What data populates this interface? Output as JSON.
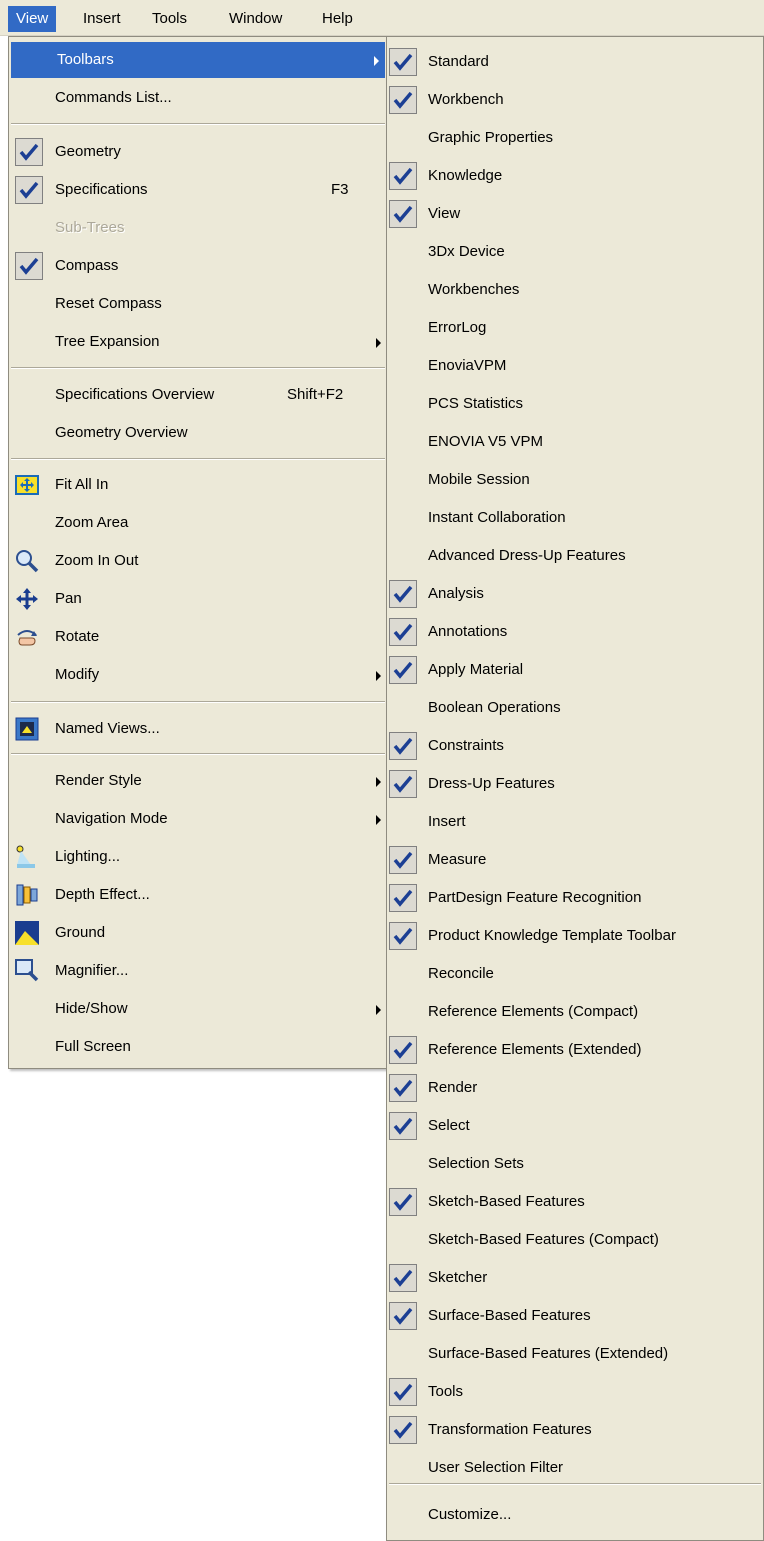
{
  "menubar": {
    "items": [
      {
        "label": "View",
        "accel": "V"
      },
      {
        "label": "Insert",
        "accel": "I"
      },
      {
        "label": "Tools",
        "accel": "T"
      },
      {
        "label": "Window",
        "accel": "W"
      },
      {
        "label": "Help",
        "accel": "H"
      }
    ],
    "active": "View"
  },
  "view_menu": {
    "toolbars": "Toolbars",
    "commands_list": "Commands List...",
    "geometry": "Geometry",
    "specifications": "Specifications",
    "specifications_shortcut": "F3",
    "sub_trees": "Sub-Trees",
    "compass": "Compass",
    "reset_compass": "Reset Compass",
    "tree_expansion": "Tree Expansion",
    "specifications_overview": "Specifications Overview",
    "specifications_overview_shortcut": "Shift+F2",
    "geometry_overview": "Geometry Overview",
    "fit_all_in": "Fit All In",
    "zoom_area": "Zoom Area",
    "zoom_in_out": "Zoom In Out",
    "pan": "Pan",
    "rotate": "Rotate",
    "modify": "Modify",
    "named_views": "Named Views...",
    "render_style": "Render Style",
    "navigation_mode": "Navigation Mode",
    "lighting": "Lighting...",
    "depth_effect": "Depth Effect...",
    "ground": "Ground",
    "magnifier": "Magnifier...",
    "hide_show": "Hide/Show",
    "full_screen": "Full Screen",
    "checked": {
      "geometry": true,
      "specifications": true,
      "compass": true
    }
  },
  "toolbars_menu": {
    "items": [
      {
        "label": "Standard",
        "checked": true
      },
      {
        "label": "Workbench",
        "checked": true
      },
      {
        "label": "Graphic Properties",
        "checked": false
      },
      {
        "label": "Knowledge",
        "checked": true
      },
      {
        "label": "View",
        "checked": true
      },
      {
        "label": "3Dx Device",
        "checked": false
      },
      {
        "label": "Workbenches",
        "checked": false
      },
      {
        "label": "ErrorLog",
        "checked": false
      },
      {
        "label": "EnoviaVPM",
        "checked": false
      },
      {
        "label": "PCS Statistics",
        "checked": false
      },
      {
        "label": "ENOVIA V5 VPM",
        "checked": false
      },
      {
        "label": "Mobile Session",
        "checked": false
      },
      {
        "label": "Instant Collaboration",
        "checked": false
      },
      {
        "label": "Advanced Dress-Up Features",
        "checked": false
      },
      {
        "label": "Analysis",
        "checked": true
      },
      {
        "label": "Annotations",
        "checked": true
      },
      {
        "label": "Apply Material",
        "checked": true
      },
      {
        "label": "Boolean Operations",
        "checked": false
      },
      {
        "label": "Constraints",
        "checked": true
      },
      {
        "label": "Dress-Up Features",
        "checked": true
      },
      {
        "label": "Insert",
        "checked": false
      },
      {
        "label": "Measure",
        "checked": true
      },
      {
        "label": "PartDesign Feature Recognition",
        "checked": true
      },
      {
        "label": "Product Knowledge Template Toolbar",
        "checked": true
      },
      {
        "label": "Reconcile",
        "checked": false
      },
      {
        "label": "Reference Elements (Compact)",
        "checked": false
      },
      {
        "label": "Reference Elements (Extended)",
        "checked": true
      },
      {
        "label": "Render",
        "checked": true
      },
      {
        "label": "Select",
        "checked": true
      },
      {
        "label": "Selection Sets",
        "checked": false
      },
      {
        "label": "Sketch-Based Features",
        "checked": true
      },
      {
        "label": "Sketch-Based Features (Compact)",
        "checked": false
      },
      {
        "label": "Sketcher",
        "checked": true
      },
      {
        "label": "Surface-Based Features",
        "checked": true
      },
      {
        "label": "Surface-Based Features (Extended)",
        "checked": false
      },
      {
        "label": "Tools",
        "checked": true
      },
      {
        "label": "Transformation Features",
        "checked": true
      },
      {
        "label": "User Selection Filter",
        "checked": false
      }
    ],
    "customize": "Customize..."
  },
  "colors": {
    "menu_bg": "#ece9d8",
    "highlight": "#316ac5",
    "check": "#1c3f94",
    "disabled_text": "#aca899"
  },
  "icons": {
    "check": "check-icon",
    "fit_all_in": "fit-all-in-icon",
    "zoom": "magnifying-glass-icon",
    "pan": "pan-arrows-icon",
    "rotate": "rotate-hand-icon",
    "named_views": "named-views-icon",
    "lighting": "lamp-icon",
    "depth_effect": "depth-effect-icon",
    "ground": "ground-icon",
    "magnifier": "magnifier-icon"
  }
}
